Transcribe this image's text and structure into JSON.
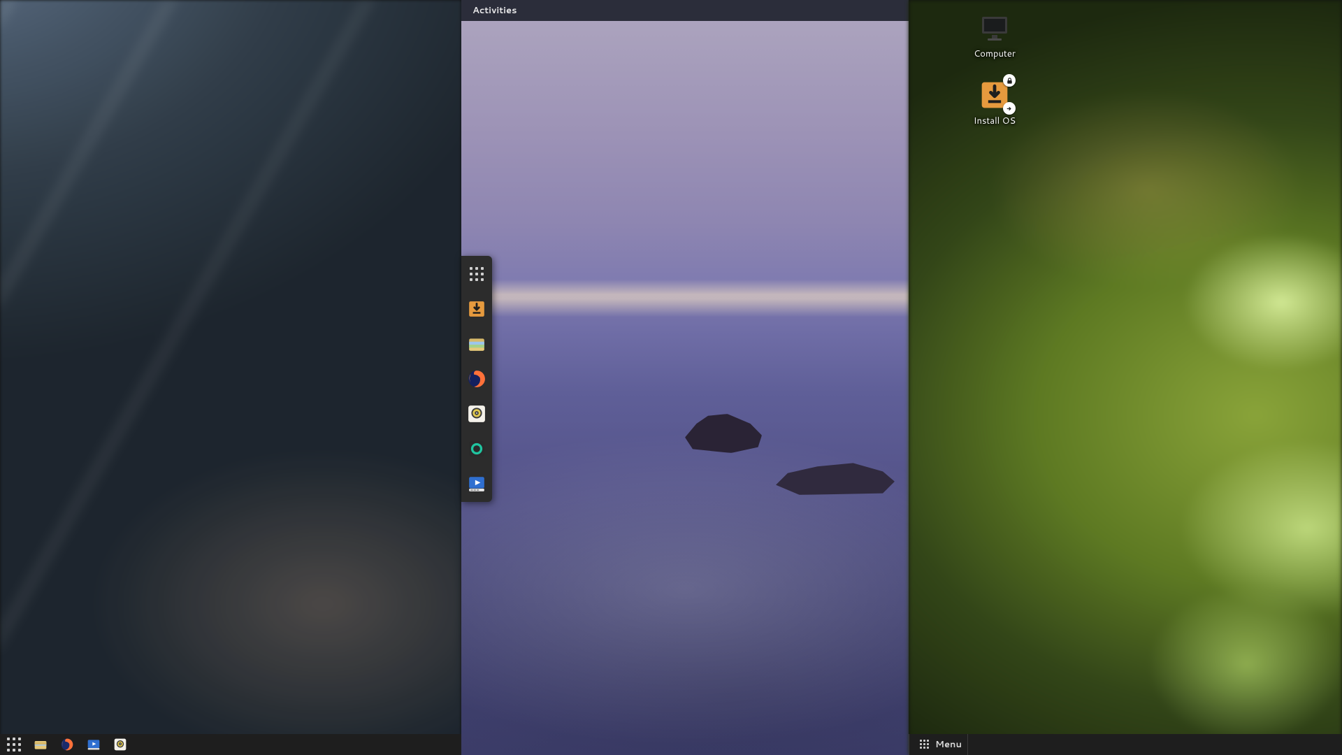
{
  "colors": {
    "accent_orange": "#e69a3e",
    "panel_bg": "#1e1e1e",
    "dock_bg": "#2c2c2c",
    "topbar_bg": "#2b2d3a"
  },
  "gnome": {
    "topbar": {
      "activities_label": "Activities"
    },
    "dock": {
      "items": [
        {
          "name": "apps-grid-icon",
          "label": "Show Applications"
        },
        {
          "name": "installer-icon",
          "label": "Install OS"
        },
        {
          "name": "files-icon",
          "label": "Files"
        },
        {
          "name": "firefox-icon",
          "label": "Firefox"
        },
        {
          "name": "rhythmbox-icon",
          "label": "Rhythmbox"
        },
        {
          "name": "keyring-icon",
          "label": "Keyring"
        },
        {
          "name": "video-icon",
          "label": "Video Player"
        }
      ]
    }
  },
  "budgie_panel_left": {
    "items": [
      {
        "name": "apps-grid-icon",
        "label": "Applications"
      },
      {
        "name": "files-icon",
        "label": "Files"
      },
      {
        "name": "firefox-icon",
        "label": "Firefox"
      },
      {
        "name": "video-icon",
        "label": "Video Player"
      },
      {
        "name": "rhythmbox-icon",
        "label": "Rhythmbox"
      }
    ]
  },
  "cinnamon_panel_right": {
    "menu_label": "Menu"
  },
  "desktop_icons": [
    {
      "name": "computer",
      "label": "Computer"
    },
    {
      "name": "install_os",
      "label": "Install OS",
      "emblems": [
        "lock",
        "link"
      ]
    }
  ]
}
